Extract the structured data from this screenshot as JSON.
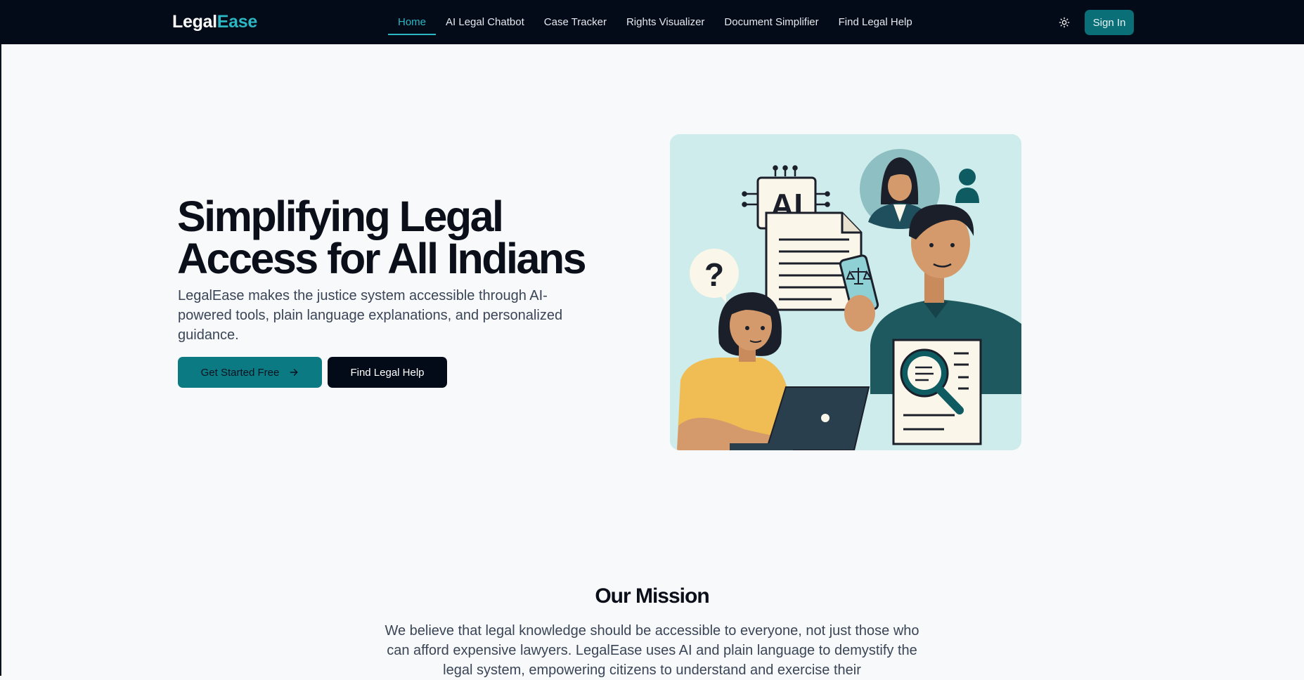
{
  "nav": {
    "brand_main": "Legal",
    "brand_accent": "Ease",
    "links": [
      {
        "label": "Home"
      },
      {
        "label": "AI Legal Chatbot"
      },
      {
        "label": "Case Tracker"
      },
      {
        "label": "Rights Visualizer"
      },
      {
        "label": "Document Simplifier"
      },
      {
        "label": "Find Legal Help"
      }
    ],
    "active_index": 0,
    "theme_icon": "sun-icon",
    "sign_in_label": "Sign In"
  },
  "hero": {
    "title": "Simplifying Legal Access for All Indians",
    "subtitle": "LegalEase makes the justice system accessible through AI-powered tools, plain language explanations, and personalized guidance.",
    "primary_button": "Get Started Free",
    "primary_button_icon": "arrow-right-icon",
    "secondary_button": "Find Legal Help",
    "illustration": {
      "ai_label": "AI",
      "question_mark": "?"
    }
  },
  "mission": {
    "title": "Our Mission",
    "text": "We believe that legal knowledge should be accessible to everyone, not just those who can afford expensive lawyers. LegalEase uses AI and plain language to demystify the legal system, empowering citizens to understand and exercise their"
  },
  "colors": {
    "accent": "#2bb7c3",
    "primary_button": "#0b7a82",
    "nav_bg": "#030a18",
    "illustration_bg": "#cdeceb"
  }
}
